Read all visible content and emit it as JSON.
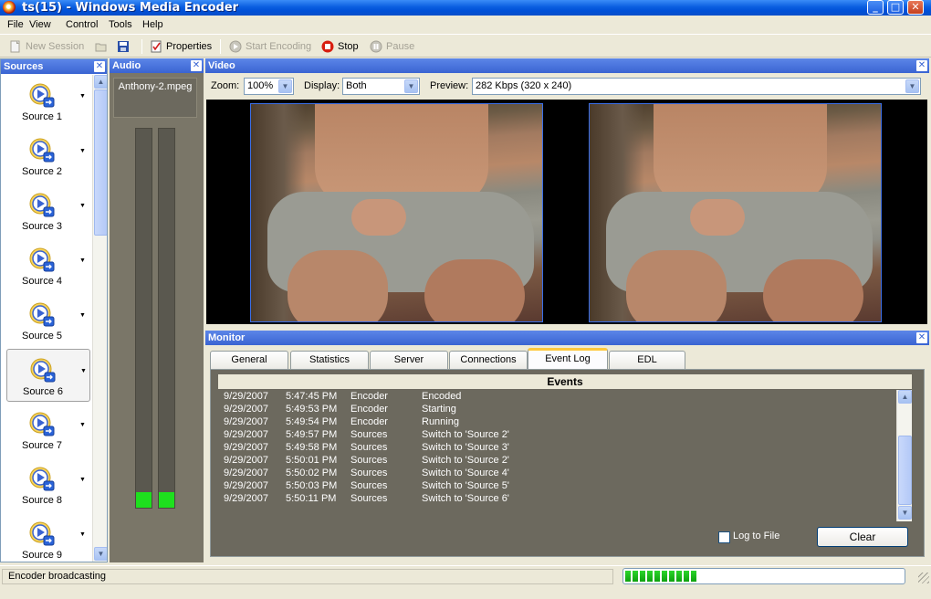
{
  "window": {
    "title": "ts(15) - Windows Media Encoder",
    "buttons": {
      "minimize": "_",
      "maximize": "□",
      "close": "✕"
    }
  },
  "menu": {
    "items": [
      {
        "label": "File",
        "accel": "F"
      },
      {
        "label": "View",
        "accel": "V"
      },
      {
        "label": "Control",
        "accel": "C"
      },
      {
        "label": "Tools",
        "accel": "T"
      },
      {
        "label": "Help",
        "accel": "H"
      }
    ]
  },
  "toolbar": {
    "new_session": "New Session",
    "properties": "Properties",
    "start_encoding": "Start Encoding",
    "stop": "Stop",
    "pause": "Pause"
  },
  "sources": {
    "header": "Sources",
    "items": [
      {
        "label": "Source 1",
        "selected": false
      },
      {
        "label": "Source 2",
        "selected": false
      },
      {
        "label": "Source 3",
        "selected": false
      },
      {
        "label": "Source 4",
        "selected": false
      },
      {
        "label": "Source 5",
        "selected": false
      },
      {
        "label": "Source 6",
        "selected": true
      },
      {
        "label": "Source 7",
        "selected": false
      },
      {
        "label": "Source 8",
        "selected": false
      },
      {
        "label": "Source 9",
        "selected": false
      }
    ]
  },
  "audio": {
    "header": "Audio",
    "file": "Anthony-2.mpeg",
    "meter_left_level": 0.04,
    "meter_right_level": 0.04
  },
  "video": {
    "header": "Video",
    "zoom_label": "Zoom:",
    "zoom_value": "100%",
    "display_label": "Display:",
    "display_value": "Both",
    "preview_label": "Preview:",
    "preview_value": "282 Kbps (320 x 240)"
  },
  "monitor": {
    "header": "Monitor",
    "tabs": [
      {
        "label": "General",
        "active": false
      },
      {
        "label": "Statistics",
        "active": false
      },
      {
        "label": "Server",
        "active": false
      },
      {
        "label": "Connections",
        "active": false
      },
      {
        "label": "Event Log",
        "active": true
      },
      {
        "label": "EDL",
        "active": false
      }
    ],
    "events_header": "Events",
    "events": [
      {
        "date": "9/29/2007",
        "time": "5:47:45 PM",
        "source": "Encoder",
        "message": "Encoded"
      },
      {
        "date": "9/29/2007",
        "time": "5:49:53 PM",
        "source": "Encoder",
        "message": "Starting"
      },
      {
        "date": "9/29/2007",
        "time": "5:49:54 PM",
        "source": "Encoder",
        "message": "Running"
      },
      {
        "date": "9/29/2007",
        "time": "5:49:57 PM",
        "source": "Sources",
        "message": "Switch to 'Source 2'"
      },
      {
        "date": "9/29/2007",
        "time": "5:49:58 PM",
        "source": "Sources",
        "message": "Switch to 'Source 3'"
      },
      {
        "date": "9/29/2007",
        "time": "5:50:01 PM",
        "source": "Sources",
        "message": "Switch to 'Source 2'"
      },
      {
        "date": "9/29/2007",
        "time": "5:50:02 PM",
        "source": "Sources",
        "message": "Switch to 'Source 4'"
      },
      {
        "date": "9/29/2007",
        "time": "5:50:03 PM",
        "source": "Sources",
        "message": "Switch to 'Source 5'"
      },
      {
        "date": "9/29/2007",
        "time": "5:50:11 PM",
        "source": "Sources",
        "message": "Switch to 'Source 6'"
      }
    ],
    "log_to_file": "Log to File",
    "log_to_file_checked": false,
    "clear": "Clear"
  },
  "status": {
    "text": "Encoder broadcasting",
    "progress_segments": 10
  },
  "colors": {
    "title_blue": "#0a5ee0",
    "panel_header_blue": "#3a64d2",
    "meter_green": "#1ee01e",
    "progress_green": "#0fa10f"
  }
}
